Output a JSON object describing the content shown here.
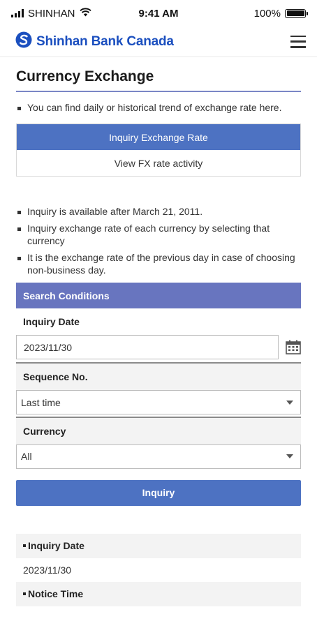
{
  "status_bar": {
    "carrier": "SHINHAN",
    "time": "9:41 AM",
    "battery": "100%",
    "battery_level": 1.0
  },
  "header": {
    "brand": "Shinhan Bank Canada",
    "brand_color": "#1b4fbf"
  },
  "page": {
    "title": "Currency Exchange",
    "intro": "You can find daily or historical trend of exchange rate here.",
    "tabs": [
      {
        "label": "Inquiry Exchange Rate",
        "active": true
      },
      {
        "label": "View FX rate activity",
        "active": false
      }
    ],
    "notes": [
      "Inquiry is available after March 21, 2011.",
      "Inquiry exchange rate of each currency by selecting that currency",
      "It is the exchange rate of the previous day in case of choosing non-business day."
    ]
  },
  "search": {
    "header": "Search Conditions",
    "inquiry_date_label": "Inquiry Date",
    "inquiry_date_value": "2023/11/30",
    "sequence_label": "Sequence No.",
    "sequence_value": "Last time",
    "currency_label": "Currency",
    "currency_value": "All",
    "button": "Inquiry"
  },
  "result": {
    "inquiry_date_label": "Inquiry Date",
    "inquiry_date_value": "2023/11/30",
    "notice_time_label": "Notice Time"
  },
  "colors": {
    "accent": "#4d72c2",
    "section": "#6875bf",
    "rule": "#7a86c6"
  },
  "icons": [
    "signal-icon",
    "wifi-icon",
    "battery-icon",
    "shinhan-logo-icon",
    "menu-icon",
    "calendar-icon",
    "chevron-down-icon"
  ]
}
